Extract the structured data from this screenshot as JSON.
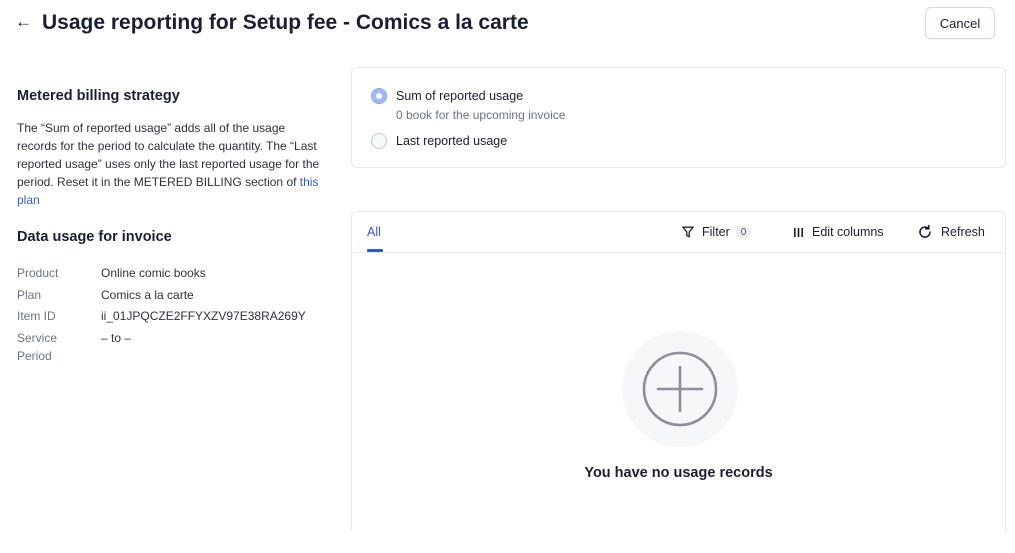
{
  "header": {
    "back_icon": "arrow-left-icon",
    "title": "Usage reporting for Setup fee - Comics a la carte",
    "cancel_label": "Cancel"
  },
  "strategy": {
    "title": "Metered billing strategy",
    "desc_text": "The “Sum of reported usage” adds all of the usage records for the period to calculate the quantity. The “Last reported usage” uses only the last reported usage for the period. Reset it in the METERED BILLING section of ",
    "link_text": "this plan",
    "options": [
      {
        "label": "Sum of reported usage",
        "sublabel": "0 book for the upcoming invoice",
        "selected": true
      },
      {
        "label": "Last reported usage",
        "selected": false
      }
    ]
  },
  "invoice": {
    "title": "Data usage for invoice",
    "rows": [
      {
        "key": "Product",
        "value": "Online comic books"
      },
      {
        "key": "Plan",
        "value": "Comics a la carte"
      },
      {
        "key": "Item ID",
        "value": "ii_01JPQCZE2FFYXZV97E38RA269Y"
      },
      {
        "key": "Service Period",
        "value": "– to –"
      }
    ]
  },
  "records": {
    "tab_all": "All",
    "filter_label": "Filter",
    "filter_count": "0",
    "edit_columns_label": "Edit columns",
    "refresh_label": "Refresh",
    "empty_icon": "plus-circle-icon",
    "empty_message": "You have no usage records"
  },
  "colors": {
    "accent": "#2b5bd7",
    "text": "#1a1f36",
    "muted": "#6a7383",
    "border": "#e3e8ee",
    "radio_selected": "#a4b8f5"
  }
}
